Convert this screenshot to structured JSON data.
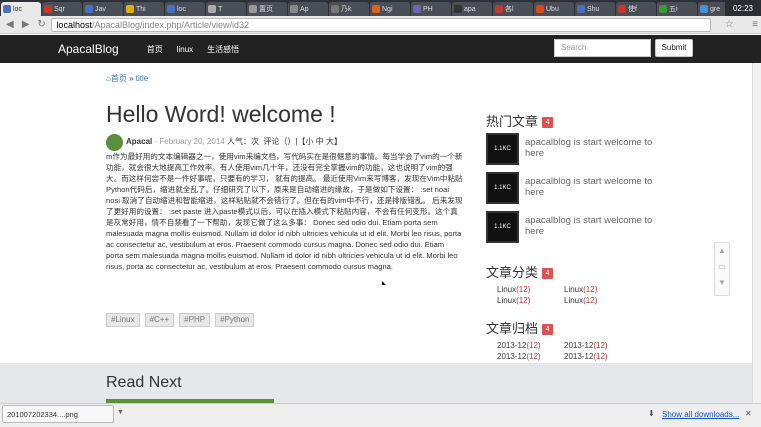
{
  "browser": {
    "tabs": [
      {
        "label": "loc",
        "color": "#4a6fbb"
      },
      {
        "label": "Sqr",
        "color": "#c0392b"
      },
      {
        "label": "Jav",
        "color": "#4a6fbb"
      },
      {
        "label": "Thi",
        "color": "#e0b000"
      },
      {
        "label": "loc",
        "color": "#4a6fbb"
      },
      {
        "label": "T",
        "color": "#aaaaaa"
      },
      {
        "label": "置页",
        "color": "#999999"
      },
      {
        "label": "Ap",
        "color": "#888888"
      },
      {
        "label": "乃k",
        "color": "#777777"
      },
      {
        "label": "Ngi",
        "color": "#e06020"
      },
      {
        "label": "PH",
        "color": "#6a6aaa"
      },
      {
        "label": "apa",
        "color": "#333333"
      },
      {
        "label": "各l",
        "color": "#c0392b"
      },
      {
        "label": "Ubu",
        "color": "#dd4814"
      },
      {
        "label": "Shu",
        "color": "#4a6fbb"
      },
      {
        "label": "使f",
        "color": "#c0392b"
      },
      {
        "label": "五i",
        "color": "#3a9a3a"
      },
      {
        "label": "gre",
        "color": "#4a90d9"
      }
    ],
    "active_tab_index": 0,
    "clock": "02:23",
    "url_host": "localhost",
    "url_path": "/ApacalBlog/index.php/Article/view/id32",
    "back_icon": "back-arrow-icon",
    "forward_icon": "forward-arrow-icon",
    "reload_icon": "reload-icon"
  },
  "nav": {
    "brand": "ApacalBlog",
    "links": [
      "首页",
      "linux",
      "生活感悟"
    ],
    "search_placeholder": "Search",
    "submit_label": "Submit"
  },
  "breadcrumb": {
    "home": "首页",
    "separator": "»",
    "current": "title"
  },
  "article": {
    "title": "Hello Word! welcome !",
    "author": "Apacal",
    "date": "· February 20, 2014",
    "popularity": "人气：次",
    "comments": "评论（）|【小 中 大】",
    "body": "m作为最好用的文本编辑器之一，使用vim来编文档，写代码实在是很惬意的事情。每当学会了vim的一个新 功能，就会很大地提高工作效率。有人使用vim几十年，还没有完全掌握vim的功能，这也说明了vim的强大。而这样何尝不是一件好事呢，只要有的学习， 就有的提高。 最近使用Vim来写博客，发现在Vim中粘贴Python代码后，缩进就全乱了。仔细研究了以下，原来是自动缩进的缘故，于是做如下设置： :set noai nosi 取消了自动缩进和智能缩进，这样粘贴就不会错行了。但在有的vim中不行，还是排版错乱。 后来发现了更好用的设置： :set paste 进入paste模式以后，可以在插入模式下粘贴内容，不会有任何变形。这个真是灰常好用，情不自禁看了一下帮助，发现它做了这么多事： Donec sed odio dui. Etiam porta sem malesuada magna mollis euismod. Nullam id dolor id nibh ultricies vehicula ut id elit. Morbi leo risus, porta ac consectetur ac, vestibulum at eros. Praesent commodo cursus magna. Donec sed odio dui. Etiam porta sem malesuada magna mollis euismod. Nullam id dolor id nibh ultricies vehicula ut id elit. Morbi leo risus, porta ac consectetur ac, vestibulum at eros. Praesent commodo cursus magna.",
    "tags": [
      "#Linux",
      "#C++",
      "#PHP",
      "#Python"
    ]
  },
  "sidebar": {
    "hot": {
      "heading": "热门文章",
      "count": "4",
      "items": [
        {
          "thumb": "1.1KC",
          "text": "apacalblog is start welcome to here"
        },
        {
          "thumb": "1.1KC",
          "text": "apacalblog is start welcome to here"
        },
        {
          "thumb": "1.1KC",
          "text": "apacalblog is start welcome to here"
        }
      ]
    },
    "categories": {
      "heading": "文章分类",
      "count": "4",
      "items": [
        {
          "name": "Linux",
          "num": "(12)"
        },
        {
          "name": "Linux",
          "num": "(12)"
        },
        {
          "name": "Linux",
          "num": "(12)"
        },
        {
          "name": "Linux",
          "num": "(12)"
        }
      ]
    },
    "archive": {
      "heading": "文章归档",
      "count": "4",
      "items": [
        {
          "name": "2013-12",
          "num": "(12)"
        },
        {
          "name": "2013-12",
          "num": "(12)"
        },
        {
          "name": "2013-12",
          "num": "(12)"
        },
        {
          "name": "2013-12",
          "num": "(12)"
        }
      ]
    }
  },
  "read_more": {
    "heading": "Read Next"
  },
  "downloads": {
    "file": "201007202334....png",
    "show_all": "Show all downloads..."
  }
}
